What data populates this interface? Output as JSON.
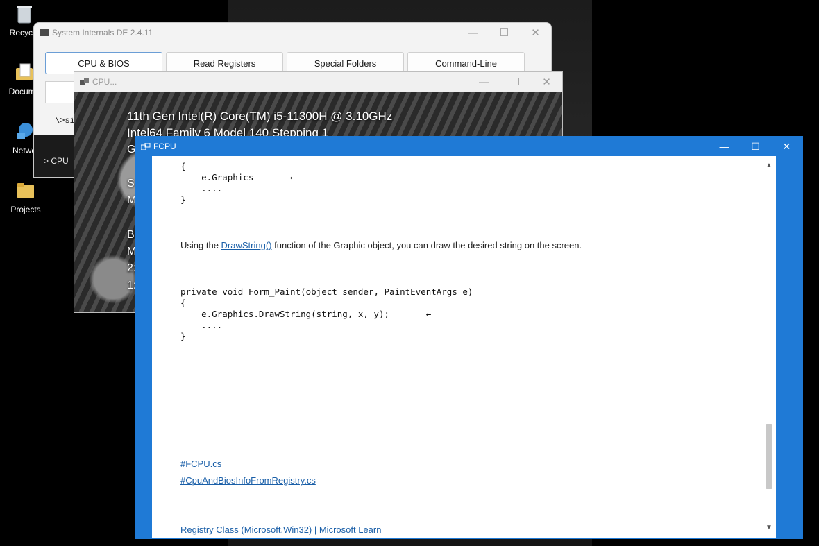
{
  "desktop": {
    "icons": [
      {
        "label": "Recycle",
        "icon": "recycle-bin-icon"
      },
      {
        "label": "Docume",
        "icon": "documents-folder-icon"
      },
      {
        "label": "Netwo",
        "icon": "network-icon"
      },
      {
        "label": "Projects",
        "icon": "folder-icon"
      }
    ]
  },
  "sys_window": {
    "title": "System Internals DE 2.4.11",
    "tabs": [
      "CPU & BIOS",
      "Read Registers",
      "Special Folders",
      "Command-Line"
    ],
    "cmd_text": "\\>si",
    "tree_item": "> CPU",
    "controls": {
      "minimize": "—",
      "maximize": "☐",
      "close": "✕"
    }
  },
  "cpu_window": {
    "title": "CPU...",
    "lines": [
      "11th Gen Intel(R) Core(TM) i5-11300H @ 3.10GHz",
      "Intel64 Family 6 Model 140 Stepping 1"
    ],
    "fragments": [
      "G",
      "S",
      "M",
      "B",
      "M",
      "2:",
      "1:"
    ],
    "controls": {
      "minimize": "—",
      "maximize": "☐",
      "close": "✕"
    }
  },
  "fcpu_window": {
    "title": "FCPU",
    "controls": {
      "minimize": "—",
      "maximize": "☐",
      "close": "✕"
    },
    "code_block_1": "{\n    e.Graphics       ←\n    ....\n}",
    "paragraph": {
      "before": "Using the ",
      "link": "DrawString()",
      "after": " function of the Graphic object, you can draw the desired string on the screen."
    },
    "code_block_2": "private void Form_Paint(object sender, PaintEventArgs e)\n{\n    e.Graphics.DrawString(string, x, y);       ←\n    ....\n}",
    "hashtags": [
      "#FCPU.cs",
      "#CpuAndBiosInfoFromRegistry.cs"
    ],
    "footer_link": "Registry Class (Microsoft.Win32) | Microsoft Learn"
  }
}
